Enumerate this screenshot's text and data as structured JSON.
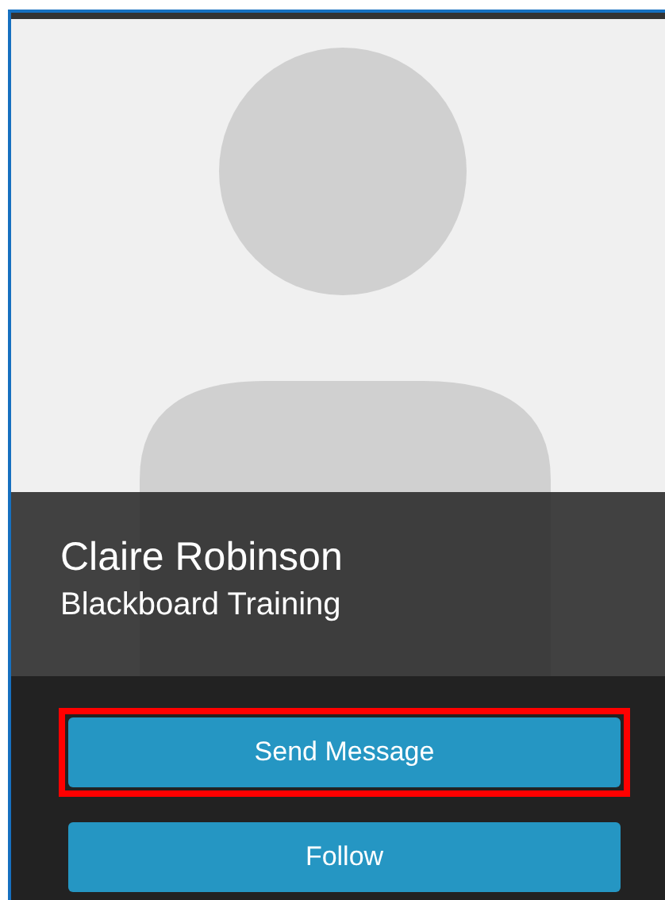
{
  "profile": {
    "name": "Claire Robinson",
    "organization": "Blackboard Training"
  },
  "buttons": [
    {
      "label": "Send Message",
      "highlighted": true
    },
    {
      "label": "Follow",
      "highlighted": false
    }
  ]
}
